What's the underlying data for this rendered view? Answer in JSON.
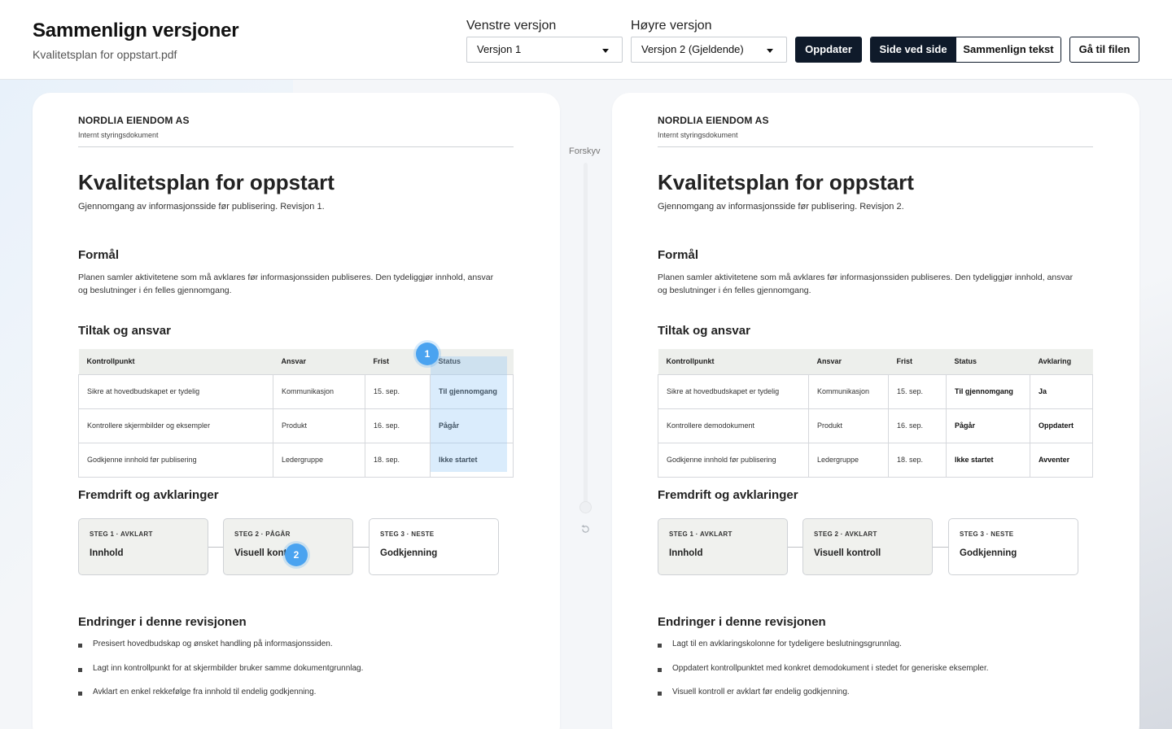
{
  "header": {
    "title": "Sammenlign versjoner",
    "file": "Kvalitetsplan for oppstart.pdf",
    "left_label": "Venstre versjon",
    "left_value": "Versjon 1",
    "right_label": "Høyre versjon",
    "right_value": "Versjon 2 (Gjeldende)",
    "update_label": "Oppdater",
    "view_side": "Side ved side",
    "view_text": "Sammenlign tekst",
    "goto_file": "Gå til filen"
  },
  "slider": {
    "label": "Forskyv"
  },
  "markers": [
    "1",
    "2"
  ],
  "left": {
    "org": "NORDLIA EIENDOM AS",
    "org_sub": "Internt styringsdokument",
    "title": "Kvalitetsplan for oppstart",
    "subtitle": "Gjennomgang av informasjonsside før publisering. Revisjon 1.",
    "purpose_h": "Formål",
    "purpose": "Planen samler aktivitetene som må avklares før informasjonssiden publiseres. Den tydeliggjør innhold, ansvar og beslutninger i én felles gjennomgang.",
    "actions_h": "Tiltak og ansvar",
    "table": {
      "headers": [
        "Kontrollpunkt",
        "Ansvar",
        "Frist",
        "Status"
      ],
      "rows": [
        [
          "Sikre at hovedbudskapet er tydelig",
          "Kommunikasjon",
          "15. sep.",
          "Til gjennomgang"
        ],
        [
          "Kontrollere skjermbilder og eksempler",
          "Produkt",
          "16. sep.",
          "Pågår"
        ],
        [
          "Godkjenne innhold før publisering",
          "Ledergruppe",
          "18. sep.",
          "Ikke startet"
        ]
      ]
    },
    "progress_h": "Fremdrift og avklaringer",
    "steps": [
      {
        "kicker": "STEG 1 · AVKLART",
        "name": "Innhold"
      },
      {
        "kicker": "STEG 2 · PÅGÅR",
        "name": "Visuell kontroll"
      },
      {
        "kicker": "STEG 3 · NESTE",
        "name": "Godkjenning"
      }
    ],
    "changes_h": "Endringer i denne revisjonen",
    "changes": [
      "Presisert hovedbudskap og ønsket handling på informasjonssiden.",
      "Lagt inn kontrollpunkt for at skjermbilder bruker samme dokumentgrunnlag.",
      "Avklart en enkel rekkefølge fra innhold til endelig godkjenning."
    ]
  },
  "right": {
    "org": "NORDLIA EIENDOM AS",
    "org_sub": "Internt styringsdokument",
    "title": "Kvalitetsplan for oppstart",
    "subtitle": "Gjennomgang av informasjonsside før publisering. Revisjon 2.",
    "purpose_h": "Formål",
    "purpose": "Planen samler aktivitetene som må avklares før informasjonssiden publiseres. Den tydeliggjør innhold, ansvar og beslutninger i én felles gjennomgang.",
    "actions_h": "Tiltak og ansvar",
    "table": {
      "headers": [
        "Kontrollpunkt",
        "Ansvar",
        "Frist",
        "Status",
        "Avklaring"
      ],
      "rows": [
        [
          "Sikre at hovedbudskapet er tydelig",
          "Kommunikasjon",
          "15. sep.",
          "Til gjennomgang",
          "Ja"
        ],
        [
          "Kontrollere demodokument",
          "Produkt",
          "16. sep.",
          "Pågår",
          "Oppdatert"
        ],
        [
          "Godkjenne innhold før publisering",
          "Ledergruppe",
          "18. sep.",
          "Ikke startet",
          "Avventer"
        ]
      ]
    },
    "progress_h": "Fremdrift og avklaringer",
    "steps": [
      {
        "kicker": "STEG 1 · AVKLART",
        "name": "Innhold"
      },
      {
        "kicker": "STEG 2 · AVKLART",
        "name": "Visuell kontroll"
      },
      {
        "kicker": "STEG 3 · NESTE",
        "name": "Godkjenning"
      }
    ],
    "changes_h": "Endringer i denne revisjonen",
    "changes": [
      "Lagt til en avklaringskolonne for tydeligere beslutningsgrunnlag.",
      "Oppdatert kontrollpunktet med konkret demodokument i stedet for generiske eksempler.",
      "Visuell kontroll er avklart før endelig godkjenning."
    ]
  }
}
